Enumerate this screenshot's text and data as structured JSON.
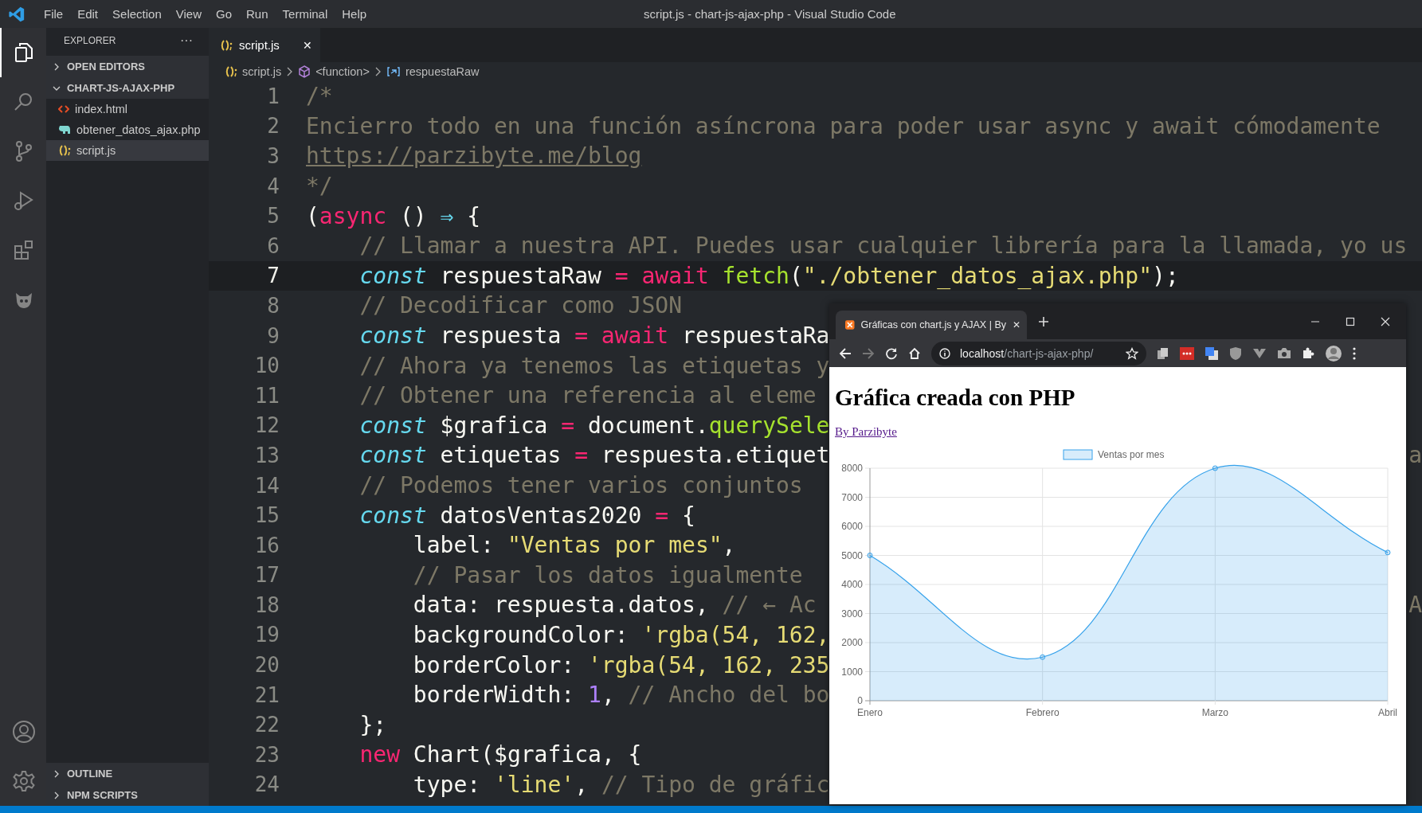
{
  "menu": [
    "File",
    "Edit",
    "Selection",
    "View",
    "Go",
    "Run",
    "Terminal",
    "Help"
  ],
  "window": {
    "title": "script.js - chart-js-ajax-php - Visual Studio Code"
  },
  "activity_bar": [
    {
      "kind": "explorer",
      "selected": true
    },
    {
      "kind": "search",
      "selected": false
    },
    {
      "kind": "source-control",
      "selected": false
    },
    {
      "kind": "run",
      "selected": false
    },
    {
      "kind": "extensions",
      "selected": false
    },
    {
      "kind": "creature",
      "selected": false
    }
  ],
  "sidebar": {
    "title": "EXPLORER",
    "more": "···",
    "sections": [
      {
        "label": "OPEN EDITORS",
        "expanded": false
      },
      {
        "label": "CHART-JS-AJAX-PHP",
        "expanded": true,
        "children": [
          {
            "label": "index.html",
            "kind": "html",
            "selected": false
          },
          {
            "label": "obtener_datos_ajax.php",
            "kind": "php",
            "selected": false
          },
          {
            "label": "script.js",
            "kind": "js",
            "selected": true
          }
        ]
      }
    ],
    "bottom_sections": [
      {
        "label": "OUTLINE",
        "expanded": false
      },
      {
        "label": "NPM SCRIPTS",
        "expanded": false
      }
    ]
  },
  "editor_tab": {
    "label": "script.js",
    "close": "✕"
  },
  "breadcrumbs": [
    {
      "kind": "file",
      "label": "script.js"
    },
    {
      "kind": "function",
      "label": "<function>"
    },
    {
      "kind": "variable",
      "label": "respuestaRaw"
    }
  ],
  "code": [
    {
      "n": "1",
      "current": false,
      "tokens": [
        {
          "kind": "comment",
          "text": "/*"
        }
      ]
    },
    {
      "n": "2",
      "current": false,
      "tokens": [
        {
          "kind": "comment",
          "text": "Encierro todo en una función asíncrona para poder usar async y await cómodamente"
        }
      ]
    },
    {
      "n": "3",
      "current": false,
      "tokens": [
        {
          "kind": "link",
          "text": "https://parzibyte.me/blog"
        }
      ]
    },
    {
      "n": "4",
      "current": false,
      "tokens": [
        {
          "kind": "comment",
          "text": "*/"
        }
      ]
    },
    {
      "n": "5",
      "current": false,
      "tokens": [
        {
          "kind": "plain",
          "text": "("
        },
        {
          "kind": "storage",
          "text": "async"
        },
        {
          "kind": "plain",
          "text": " () "
        },
        {
          "kind": "arrow",
          "text": "⇒"
        },
        {
          "kind": "plain",
          "text": " {"
        }
      ]
    },
    {
      "n": "6",
      "current": false,
      "tokens": [
        {
          "kind": "comment",
          "text": "    // Llamar a nuestra API. Puedes usar cualquier librería para la llamada, yo us"
        }
      ]
    },
    {
      "n": "7",
      "current": true,
      "tokens": [
        {
          "kind": "keyword",
          "text": "    const"
        },
        {
          "kind": "plain",
          "text": " respuestaRaw "
        },
        {
          "kind": "storage",
          "text": "="
        },
        {
          "kind": "storage",
          "text": " await"
        },
        {
          "kind": "func",
          "text": " fetch"
        },
        {
          "kind": "plain",
          "text": "("
        },
        {
          "kind": "string",
          "text": "\"./obtener_datos_ajax.php\""
        },
        {
          "kind": "plain",
          "text": ");"
        }
      ]
    },
    {
      "n": "8",
      "current": false,
      "tokens": [
        {
          "kind": "comment",
          "text": "    // Decodificar como JSON"
        }
      ]
    },
    {
      "n": "9",
      "current": false,
      "tokens": [
        {
          "kind": "keyword",
          "text": "    const"
        },
        {
          "kind": "plain",
          "text": " respuesta "
        },
        {
          "kind": "storage",
          "text": "="
        },
        {
          "kind": "storage",
          "text": " await"
        },
        {
          "kind": "plain",
          "text": " respuestaRa"
        }
      ]
    },
    {
      "n": "10",
      "current": false,
      "tokens": [
        {
          "kind": "comment",
          "text": "    // Ahora ya tenemos las etiquetas y"
        }
      ]
    },
    {
      "n": "11",
      "current": false,
      "tokens": [
        {
          "kind": "comment",
          "text": "    // Obtener una referencia al eleme"
        }
      ]
    },
    {
      "n": "12",
      "current": false,
      "tokens": [
        {
          "kind": "keyword",
          "text": "    const"
        },
        {
          "kind": "plain",
          "text": " $grafica "
        },
        {
          "kind": "storage",
          "text": "="
        },
        {
          "kind": "plain",
          "text": " document."
        },
        {
          "kind": "func",
          "text": "querySele"
        }
      ]
    },
    {
      "n": "13",
      "current": false,
      "tokens": [
        {
          "kind": "keyword",
          "text": "    const"
        },
        {
          "kind": "plain",
          "text": " etiquetas "
        },
        {
          "kind": "storage",
          "text": "="
        },
        {
          "kind": "plain",
          "text": " respuesta.etiquet"
        }
      ],
      "right": "a"
    },
    {
      "n": "14",
      "current": false,
      "tokens": [
        {
          "kind": "comment",
          "text": "    // Podemos tener varios conjuntos"
        }
      ]
    },
    {
      "n": "15",
      "current": false,
      "tokens": [
        {
          "kind": "keyword",
          "text": "    const"
        },
        {
          "kind": "plain",
          "text": " datosVentas2020 "
        },
        {
          "kind": "storage",
          "text": "="
        },
        {
          "kind": "plain",
          "text": " {"
        }
      ]
    },
    {
      "n": "16",
      "current": false,
      "tokens": [
        {
          "kind": "plain",
          "text": "        label: "
        },
        {
          "kind": "string",
          "text": "\"Ventas por mes\""
        },
        {
          "kind": "plain",
          "text": ","
        }
      ]
    },
    {
      "n": "17",
      "current": false,
      "tokens": [
        {
          "kind": "comment",
          "text": "        // Pasar los datos igualmente"
        }
      ]
    },
    {
      "n": "18",
      "current": false,
      "tokens": [
        {
          "kind": "plain",
          "text": "        data: respuesta.datos, "
        },
        {
          "kind": "comment",
          "text": "// ← Ac"
        }
      ],
      "right": "A"
    },
    {
      "n": "19",
      "current": false,
      "tokens": [
        {
          "kind": "plain",
          "text": "        backgroundColor: "
        },
        {
          "kind": "string",
          "text": "'rgba(54, 162,"
        }
      ]
    },
    {
      "n": "20",
      "current": false,
      "tokens": [
        {
          "kind": "plain",
          "text": "        borderColor: "
        },
        {
          "kind": "string",
          "text": "'rgba(54, 162, 235"
        }
      ]
    },
    {
      "n": "21",
      "current": false,
      "tokens": [
        {
          "kind": "plain",
          "text": "        borderWidth: "
        },
        {
          "kind": "number",
          "text": "1"
        },
        {
          "kind": "plain",
          "text": ", "
        },
        {
          "kind": "comment",
          "text": "// Ancho del bo"
        }
      ]
    },
    {
      "n": "22",
      "current": false,
      "tokens": [
        {
          "kind": "plain",
          "text": "    };"
        }
      ]
    },
    {
      "n": "23",
      "current": false,
      "tokens": [
        {
          "kind": "storage",
          "text": "    new"
        },
        {
          "kind": "plain",
          "text": " Chart($grafica, {"
        }
      ]
    },
    {
      "n": "24",
      "current": false,
      "tokens": [
        {
          "kind": "plain",
          "text": "        type: "
        },
        {
          "kind": "string",
          "text": "'line'"
        },
        {
          "kind": "plain",
          "text": ", "
        },
        {
          "kind": "comment",
          "text": "// Tipo de gráfic"
        }
      ]
    }
  ],
  "browser": {
    "tab_title": "Gráficas con chart.js y AJAX | By",
    "tab_close": "✕",
    "url": {
      "host": "localhost",
      "path": "/chart-js-ajax-php/"
    },
    "page": {
      "heading": "Gráfica creada con PHP",
      "link": "By Parzibyte",
      "chart_data": {
        "type": "area",
        "grid": true,
        "categories": [
          "Enero",
          "Febrero",
          "Marzo",
          "Abril"
        ],
        "series": [
          {
            "name": "Ventas por mes",
            "color": "#36a2eb",
            "marker": true,
            "values": [
              5000,
              1500,
              8000,
              5100
            ]
          }
        ],
        "ylim": [
          0,
          8000
        ],
        "yticks": [
          0,
          1000,
          2000,
          3000,
          4000,
          5000,
          6000,
          7000,
          8000
        ]
      }
    }
  }
}
